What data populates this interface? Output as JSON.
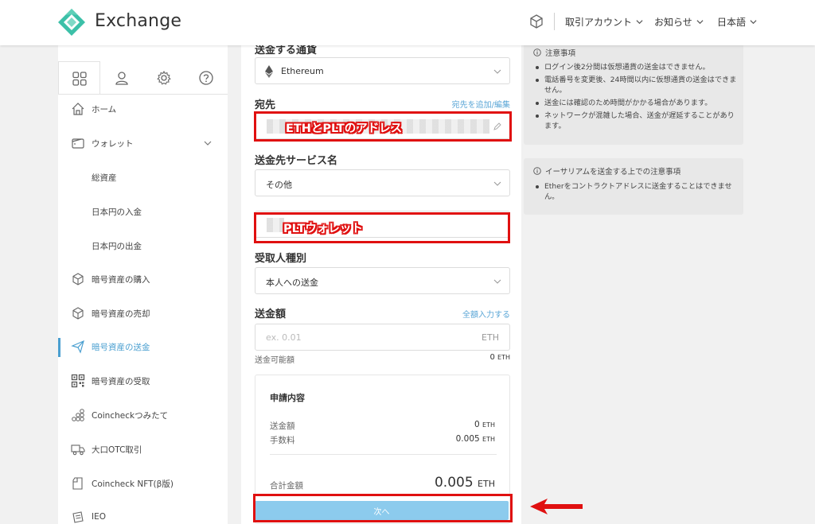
{
  "header": {
    "brand": "Exchange",
    "menu": [
      {
        "label": "取引アカウント"
      },
      {
        "label": "お知らせ"
      },
      {
        "label": "日本語"
      }
    ],
    "accent": "#3cc0a8"
  },
  "sidebar": {
    "tabs": [
      {
        "icon": "grid-icon"
      },
      {
        "icon": "user-icon"
      },
      {
        "icon": "gear-icon"
      },
      {
        "icon": "help-icon"
      }
    ],
    "items": [
      {
        "label": "ホーム",
        "icon": "home-icon"
      },
      {
        "label": "ウォレット",
        "icon": "wallet-icon"
      },
      {
        "label": "総資産"
      },
      {
        "label": "日本円の入金"
      },
      {
        "label": "日本円の出金"
      },
      {
        "label": "暗号資産の購入",
        "icon": "cube-icon"
      },
      {
        "label": "暗号資産の売却",
        "icon": "cube-icon"
      },
      {
        "label": "暗号資産の送金",
        "icon": "send-icon",
        "active": true
      },
      {
        "label": "暗号資産の受取",
        "icon": "qr-icon"
      },
      {
        "label": "Coincheckつみたて",
        "icon": "coins-icon"
      },
      {
        "label": "大口OTC取引",
        "icon": "truck-icon"
      },
      {
        "label": "Coincheck NFT(β版)",
        "icon": "nft-card-icon"
      },
      {
        "label": "IEO",
        "icon": "ieo-icon"
      }
    ],
    "active_color": "#4a9fd0"
  },
  "form": {
    "currency_label": "送金する通貨",
    "currency_value": "Ethereum",
    "destination_label": "宛先",
    "destination_link": "宛先を追加/編集",
    "destination_annotation": "ETHとPLTのアドレス",
    "service_label": "送金先サービス名",
    "service_value": "その他",
    "service_annotation": "PLTウォレット",
    "recipient_type_label": "受取人種別",
    "recipient_type_value": "本人への送金",
    "amount_label": "送金額",
    "amount_link": "全額入力する",
    "amount_placeholder": "ex. 0.01",
    "amount_unit": "ETH",
    "available_label": "送金可能額",
    "available_value": "0",
    "available_unit": "ETH",
    "summary": {
      "title": "申請内容",
      "amount_label": "送金額",
      "amount_value": "0",
      "amount_unit": "ETH",
      "fee_label": "手数料",
      "fee_value": "0.005",
      "fee_unit": "ETH",
      "total_label": "合計金額",
      "total_value": "0.005",
      "total_unit": "ETH"
    },
    "next_button": "次へ",
    "button_color": "#8ccbed",
    "annotation_color": "#e01010"
  },
  "notices": [
    {
      "title": "注意事項",
      "items": [
        "ログイン後2分間は仮想通貨の送金はできません。",
        "電話番号を変更後、24時間以内に仮想通貨の送金はできません。",
        "送金には確認のため時間がかかる場合があります。",
        "ネットワークが混雑した場合、送金が遅延することがあります。"
      ]
    },
    {
      "title": "イーサリアムを送金する上での注意事項",
      "items": [
        "Etherをコントラクトアドレスに送金することはできません。"
      ]
    }
  ]
}
